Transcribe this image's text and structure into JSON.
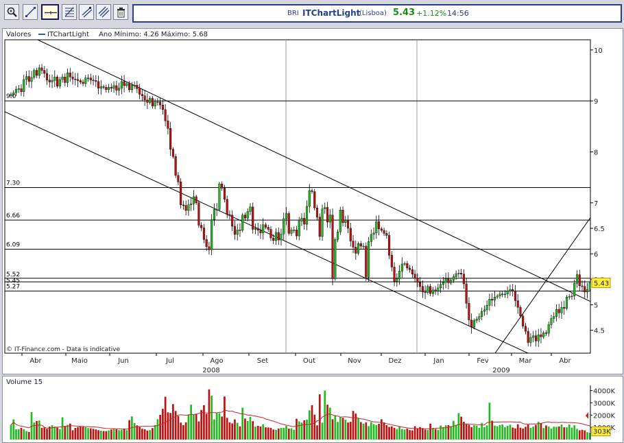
{
  "toolbar": {
    "buttons": [
      {
        "name": "zoom-tool-button",
        "icon": "magnifier-icon"
      },
      {
        "name": "trendline-tool-button",
        "icon": "diagonal-line-icon"
      },
      {
        "name": "horizontal-line-tool-button",
        "icon": "horizontal-line-icon"
      },
      {
        "name": "fibonacci-tool-button",
        "icon": "fibonacci-icon"
      },
      {
        "name": "channel-tool-button",
        "icon": "channel-icon"
      },
      {
        "name": "parallel-lines-tool-button",
        "icon": "parallel-lines-icon"
      },
      {
        "name": "delete-tool-button",
        "icon": "trash-icon"
      }
    ]
  },
  "quote": {
    "symbol": "BRI",
    "app_name": "ITChartLight",
    "exchange": "(Lisboa)",
    "price": "5.43",
    "change": "+1.12%",
    "time": "14:56",
    "colors": {
      "symbol": "#2a3f8a",
      "price": "#1a8a1a",
      "change": "#1a8a1a"
    }
  },
  "price_panel": {
    "label": "Valores",
    "series_name": "ITChartLight",
    "range_text": "Ano Mínimo: 4.26 Máximo: 5.68",
    "footer": "© IT-Finance.com - Data is indicative",
    "current_badge": "5.43"
  },
  "volume_panel": {
    "label": "Volume 15",
    "current_badge": "303K"
  },
  "chart_data": {
    "type": "candlestick",
    "ylim": [
      4.05,
      10.2
    ],
    "y_ticks": [
      10,
      9,
      8,
      7,
      6.5,
      6,
      5.5,
      5,
      4.5
    ],
    "x_labels": [
      "Abr",
      "Maio",
      "Jun",
      "Jul",
      "Ago",
      "Set",
      "Out",
      "Nov",
      "Dez",
      "Jan",
      "Fev",
      "Mar",
      "Abr"
    ],
    "year_labels": [
      "2008",
      "2009"
    ],
    "hlines": [
      {
        "value": 9.0,
        "label": "9.0"
      },
      {
        "value": 7.3,
        "label": "7.30"
      },
      {
        "value": 6.66,
        "label": "6.66"
      },
      {
        "value": 6.09,
        "label": "6.09"
      },
      {
        "value": 5.52,
        "label": "5.52"
      },
      {
        "value": 5.45,
        "label": "5.45"
      },
      {
        "value": 5.27,
        "label": "5.27"
      }
    ],
    "colors": {
      "up": "#22bb22",
      "down": "#bb1111",
      "grid": "#000000",
      "ma": "#cc2222"
    },
    "closes": [
      9.13,
      9.16,
      9.23,
      9.24,
      9.18,
      9.42,
      9.48,
      9.38,
      9.46,
      9.6,
      9.5,
      9.65,
      9.6,
      9.54,
      9.41,
      9.37,
      9.4,
      9.47,
      9.29,
      9.42,
      9.47,
      9.36,
      9.55,
      9.47,
      9.43,
      9.42,
      9.4,
      9.37,
      9.34,
      9.45,
      9.45,
      9.41,
      9.4,
      9.38,
      9.25,
      9.28,
      9.27,
      9.22,
      9.27,
      9.25,
      9.3,
      9.21,
      9.25,
      9.38,
      9.3,
      9.34,
      9.22,
      9.31,
      9.31,
      9.24,
      9.13,
      9.1,
      9.02,
      8.97,
      9.05,
      8.9,
      8.98,
      8.98,
      8.92,
      8.83,
      8.61,
      8.46,
      8.05,
      7.91,
      7.54,
      7.41,
      6.96,
      6.95,
      6.85,
      6.96,
      6.98,
      7.12,
      7.0,
      6.56,
      6.51,
      6.28,
      6.14,
      6.08,
      6.67,
      6.87,
      6.87,
      7.37,
      7.29,
      7.07,
      6.77,
      6.76,
      6.54,
      6.38,
      6.47,
      6.46,
      6.76,
      6.7,
      6.83,
      6.92,
      6.48,
      6.5,
      6.46,
      6.41,
      6.57,
      6.52,
      6.48,
      6.31,
      6.26,
      6.42,
      6.27,
      6.39,
      6.69,
      6.79,
      6.4,
      6.47,
      6.47,
      6.35,
      6.64,
      6.7,
      6.58,
      6.93,
      7.24,
      7.22,
      6.9,
      6.72,
      6.34,
      6.88,
      6.91,
      6.62,
      6.76,
      5.51,
      6.28,
      6.43,
      6.86,
      6.61,
      6.66,
      6.5,
      6.25,
      6.13,
      6.01,
      6.2,
      6.15,
      6.15,
      5.54,
      6.24,
      6.38,
      6.41,
      6.63,
      6.49,
      6.46,
      6.4,
      6.36,
      5.97,
      5.74,
      5.46,
      5.51,
      5.66,
      5.8,
      5.81,
      5.72,
      5.69,
      5.6,
      5.52,
      5.44,
      5.36,
      5.25,
      5.24,
      5.36,
      5.22,
      5.29,
      5.27,
      5.33,
      5.4,
      5.44,
      5.51,
      5.43,
      5.48,
      5.55,
      5.61,
      5.62,
      5.6,
      5.41,
      5.03,
      4.7,
      4.56,
      4.69,
      4.72,
      4.77,
      4.87,
      4.9,
      4.99,
      5.11,
      5.09,
      5.15,
      5.17,
      5.21,
      5.21,
      5.21,
      5.27,
      5.3,
      5.27,
      5.08,
      4.95,
      4.78,
      4.58,
      4.48,
      4.26,
      4.36,
      4.39,
      4.29,
      4.41,
      4.37,
      4.45,
      4.44,
      4.61,
      4.73,
      4.77,
      4.91,
      4.84,
      4.95,
      4.93,
      5.15,
      5.16,
      5.17,
      5.42,
      5.59,
      5.37,
      5.36,
      5.25,
      5.3,
      5.43
    ],
    "opens": [
      9.1,
      9.13,
      9.16,
      9.23,
      9.24,
      9.18,
      9.42,
      9.48,
      9.38,
      9.46,
      9.6,
      9.5,
      9.65,
      9.6,
      9.54,
      9.41,
      9.37,
      9.4,
      9.47,
      9.29,
      9.42,
      9.47,
      9.36,
      9.55,
      9.47,
      9.43,
      9.42,
      9.4,
      9.37,
      9.34,
      9.45,
      9.45,
      9.41,
      9.4,
      9.38,
      9.25,
      9.28,
      9.27,
      9.22,
      9.27,
      9.25,
      9.3,
      9.21,
      9.25,
      9.38,
      9.3,
      9.34,
      9.22,
      9.31,
      9.31,
      9.24,
      9.13,
      9.1,
      9.02,
      8.97,
      9.05,
      8.9,
      8.98,
      8.98,
      8.92,
      8.83,
      8.61,
      8.46,
      8.05,
      7.91,
      7.54,
      7.41,
      6.96,
      6.95,
      6.85,
      6.96,
      6.98,
      7.12,
      7.0,
      6.56,
      6.51,
      6.28,
      6.14,
      6.08,
      6.67,
      6.87,
      6.87,
      7.37,
      7.29,
      7.07,
      6.77,
      6.76,
      6.54,
      6.38,
      6.47,
      6.46,
      6.76,
      6.7,
      6.83,
      6.92,
      6.48,
      6.5,
      6.46,
      6.41,
      6.57,
      6.52,
      6.48,
      6.31,
      6.26,
      6.42,
      6.27,
      6.39,
      6.69,
      6.79,
      6.4,
      6.47,
      6.47,
      6.35,
      6.64,
      6.7,
      6.58,
      6.93,
      7.24,
      7.22,
      6.9,
      6.72,
      6.34,
      6.88,
      6.91,
      6.62,
      6.76,
      5.51,
      6.28,
      6.43,
      6.86,
      6.61,
      6.66,
      6.5,
      6.25,
      6.13,
      6.01,
      6.2,
      6.15,
      6.15,
      5.54,
      6.24,
      6.38,
      6.41,
      6.63,
      6.49,
      6.46,
      6.4,
      6.36,
      5.97,
      5.74,
      5.46,
      5.51,
      5.66,
      5.8,
      5.81,
      5.72,
      5.69,
      5.6,
      5.52,
      5.44,
      5.36,
      5.25,
      5.24,
      5.36,
      5.22,
      5.29,
      5.27,
      5.33,
      5.4,
      5.44,
      5.51,
      5.43,
      5.48,
      5.55,
      5.61,
      5.62,
      5.6,
      5.41,
      5.03,
      4.7,
      4.56,
      4.69,
      4.72,
      4.77,
      4.87,
      4.9,
      4.99,
      5.11,
      5.09,
      5.15,
      5.17,
      5.21,
      5.21,
      5.21,
      5.27,
      5.3,
      5.27,
      5.08,
      4.95,
      4.78,
      4.58,
      4.48,
      4.26,
      4.36,
      4.39,
      4.29,
      4.41,
      4.37,
      4.45,
      4.44,
      4.61,
      4.73,
      4.77,
      4.91,
      4.84,
      4.95,
      4.93,
      5.15,
      5.16,
      5.17,
      5.42,
      5.59,
      5.37,
      5.36,
      5.25,
      5.3
    ],
    "volume_ticks": [
      "4000K",
      "3000K",
      "2000K",
      "1000K"
    ],
    "volume_max": 4200,
    "volumes": [
      1200,
      1650,
      840,
      850,
      960,
      850,
      690,
      620,
      2240,
      1390,
      1520,
      1560,
      950,
      1000,
      880,
      1060,
      1180,
      1060,
      980,
      850,
      1820,
      1110,
      1200,
      1310,
      760,
      950,
      1020,
      1090,
      1050,
      1010,
      940,
      920,
      880,
      830,
      770,
      720,
      700,
      690,
      750,
      820,
      910,
      840,
      770,
      800,
      880,
      770,
      1590,
      1890,
      1360,
      1160,
      1030,
      880,
      840,
      730,
      770,
      940,
      1180,
      1660,
      2020,
      2510,
      3500,
      2220,
      2170,
      2900,
      2340,
      1920,
      1390,
      1180,
      1410,
      2060,
      2850,
      2070,
      2090,
      1480,
      2420,
      2810,
      2090,
      4100,
      3580,
      1650,
      2150,
      2160,
      1880,
      3520,
      1770,
      1400,
      1320,
      1650,
      1370,
      1080,
      2600,
      1720,
      1510,
      1860,
      1500,
      1060,
      1120,
      1070,
      1250,
      1000,
      990,
      960,
      820,
      790,
      900,
      950,
      960,
      1120,
      890,
      920,
      800,
      1700,
      1490,
      1390,
      1580,
      1630,
      2390,
      2810,
      2030,
      1160,
      3700,
      1380,
      4000,
      2850,
      2610,
      1660,
      1990,
      1440,
      1870,
      1780,
      1630,
      1390,
      1450,
      2340,
      2120,
      1750,
      1430,
      1300,
      1410,
      1100,
      1430,
      1260,
      1190,
      1290,
      1660,
      1400,
      1180,
      1030,
      1080,
      960,
      860,
      1090,
      860,
      820,
      890,
      780,
      750,
      1090,
      930,
      1020,
      940,
      820,
      780,
      1300,
      960,
      860,
      800,
      1150,
      1020,
      1170,
      1180,
      1060,
      1530,
      1200,
      2160,
      1870,
      1450,
      1250,
      1200,
      1020,
      1170,
      1140,
      960,
      1360,
      1020,
      1160,
      3010,
      1540,
      1140,
      1090,
      1180,
      1230,
      1010,
      1120,
      1210,
      980,
      910,
      1250,
      970,
      900,
      1040,
      1220,
      950,
      1060,
      1200,
      1450,
      1320,
      940,
      1150,
      1060,
      890,
      1050,
      1040,
      1070,
      1230,
      1000,
      1000,
      1230,
      980,
      1170,
      870,
      760,
      800,
      750,
      600,
      550,
      500,
      560,
      480,
      360
    ],
    "ma": [
      1200,
      1425,
      1230,
      1135,
      1100,
      1058,
      1005,
      958,
      1100,
      1129,
      1159,
      1192,
      1173,
      1000,
      935,
      937,
      964,
      999,
      1017,
      1030,
      1057,
      1080,
      1095,
      1123,
      1126,
      1108,
      1092,
      1078,
      1068,
      1059,
      1051,
      1043,
      1034,
      1023,
      1000,
      961,
      938,
      915,
      900,
      894,
      891,
      889,
      878,
      864,
      862,
      855,
      908,
      975,
      1019,
      1052,
      1069,
      1081,
      1085,
      1079,
      1076,
      1086,
      1110,
      1149,
      1199,
      1283,
      1418,
      1521,
      1619,
      1773,
      1891,
      1989,
      2025,
      2006,
      1991,
      2003,
      2060,
      2042,
      2084,
      2131,
      2197,
      2225,
      2166,
      2166,
      2215,
      2199,
      2182,
      2229,
      2240,
      2399,
      2357,
      2301,
      2323,
      2234,
      2203,
      2124,
      2102,
      2065,
      1991,
      2000,
      1945,
      1915,
      1872,
      1823,
      1789,
      1676,
      1628,
      1565,
      1508,
      1442,
      1355,
      1282,
      1231,
      1174,
      1132,
      1081,
      1060,
      1109,
      1140,
      1177,
      1232,
      1224,
      1237,
      1285,
      1341,
      1535,
      1604,
      1830,
      1951,
      2073,
      2089,
      2017,
      1950,
      1922,
      1831,
      1856,
      1859,
      1840,
      1811,
      1789,
      1795,
      1742,
      1686,
      1665,
      1624,
      1546,
      1499,
      1447,
      1443,
      1418,
      1408,
      1359,
      1303,
      1257,
      1216,
      1155,
      1122,
      1063,
      1021,
      987,
      955,
      930,
      915,
      904,
      898,
      893,
      879,
      878,
      880,
      879,
      879,
      917,
      937,
      942,
      957,
      976,
      1008,
      1066,
      1092,
      1163,
      1224,
      1264,
      1278,
      1280,
      1254,
      1250,
      1244,
      1219,
      1211,
      1196,
      1194,
      1388,
      1429,
      1437,
      1422,
      1430,
      1433,
      1437,
      1442,
      1448,
      1448,
      1442,
      1430,
      1421,
      1426,
      1301,
      1265,
      1265,
      1278,
      1284,
      1278,
      1297,
      1328,
      1374,
      1424,
      1439,
      1396,
      1398,
      1401,
      1395,
      1404,
      1405,
      1382,
      1386,
      1391,
      1373,
      1360,
      1329,
      1288,
      1226,
      1169,
      1114,
      1059,
      1013,
      962,
      891
    ]
  }
}
